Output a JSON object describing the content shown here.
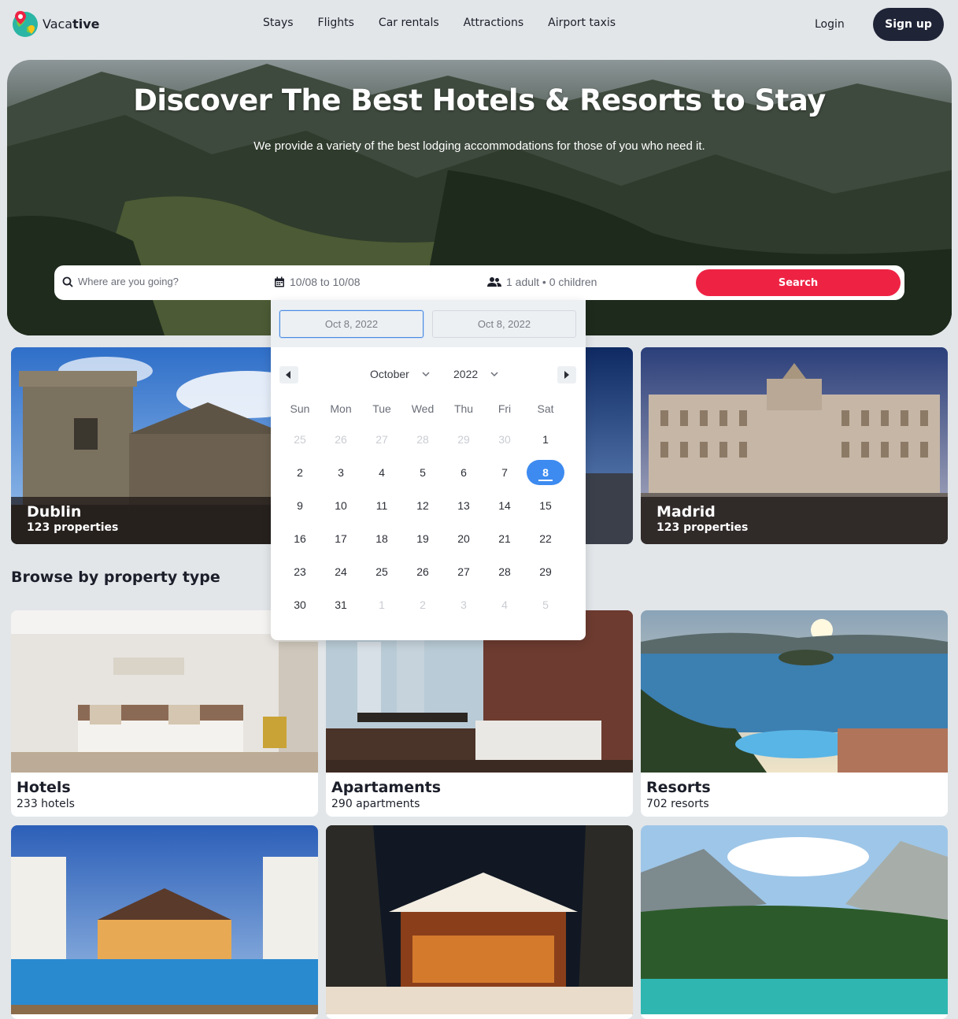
{
  "brand": {
    "name_light": "Vaca",
    "name_bold": "tive"
  },
  "nav": {
    "links": [
      "Stays",
      "Flights",
      "Car rentals",
      "Attractions",
      "Airport taxis"
    ],
    "login": "Login",
    "signup": "Sign up"
  },
  "hero": {
    "title": "Discover The Best Hotels & Resorts to Stay",
    "subtitle": "We provide a variety of the best lodging accommodations for those of you who need it."
  },
  "search": {
    "destination_placeholder": "Where are you going?",
    "dates": "10/08 to 10/08",
    "guests": "1 adult • 0 children",
    "button": "Search"
  },
  "calendar": {
    "start_date": "Oct 8, 2022",
    "end_date": "Oct 8, 2022",
    "month": "October",
    "year": "2022",
    "weekdays": [
      "Sun",
      "Mon",
      "Tue",
      "Wed",
      "Thu",
      "Fri",
      "Sat"
    ],
    "weeks": [
      [
        "25",
        "26",
        "27",
        "28",
        "29",
        "30",
        "1"
      ],
      [
        "2",
        "3",
        "4",
        "5",
        "6",
        "7",
        "8"
      ],
      [
        "9",
        "10",
        "11",
        "12",
        "13",
        "14",
        "15"
      ],
      [
        "16",
        "17",
        "18",
        "19",
        "20",
        "21",
        "22"
      ],
      [
        "23",
        "24",
        "25",
        "26",
        "27",
        "28",
        "29"
      ],
      [
        "30",
        "31",
        "1",
        "2",
        "3",
        "4",
        "5"
      ]
    ],
    "selected_day": "8",
    "colors": {
      "selected": "#3d8bf0",
      "muted": "#c9ccd2"
    }
  },
  "cities": [
    {
      "name": "Dublin",
      "count": "123 properties"
    },
    {
      "name": "Madrid",
      "count": "123 properties"
    }
  ],
  "browse": {
    "title": "Browse by property type",
    "types": [
      {
        "name": "Hotels",
        "count": "233 hotels"
      },
      {
        "name": "Apartaments",
        "count": "290 apartments"
      },
      {
        "name": "Resorts",
        "count": "702 resorts"
      }
    ]
  },
  "colors": {
    "accent": "#ee2344",
    "dark": "#1f2437",
    "background": "#e2e6e9"
  }
}
